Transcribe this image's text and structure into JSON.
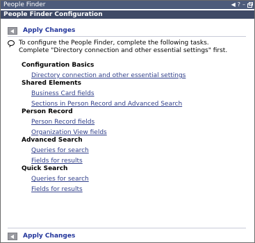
{
  "window": {
    "title": "People Finder",
    "icons": [
      "arrow-left-icon",
      "help-icon",
      "minimize-icon",
      "restore-icon"
    ]
  },
  "header": {
    "title": "People Finder Configuration"
  },
  "apply": {
    "label": "Apply Changes"
  },
  "intro": {
    "text": "To configure the People Finder, complete the following tasks. Complete \"Directory connection and other essential settings\" first."
  },
  "sections": [
    {
      "title": "Configuration Basics",
      "links": [
        "Directory connection and other essential settings"
      ]
    },
    {
      "title": "Shared Elements",
      "links": [
        "Business Card fields",
        "Sections in Person Record and Advanced Search"
      ]
    },
    {
      "title": "Person Record",
      "links": [
        "Person Record fields",
        "Organization View fields"
      ]
    },
    {
      "title": "Advanced Search",
      "links": [
        "Queries for search",
        "Fields for results"
      ]
    },
    {
      "title": "Quick Search",
      "links": [
        "Queries for search",
        "Fields for results"
      ]
    }
  ]
}
